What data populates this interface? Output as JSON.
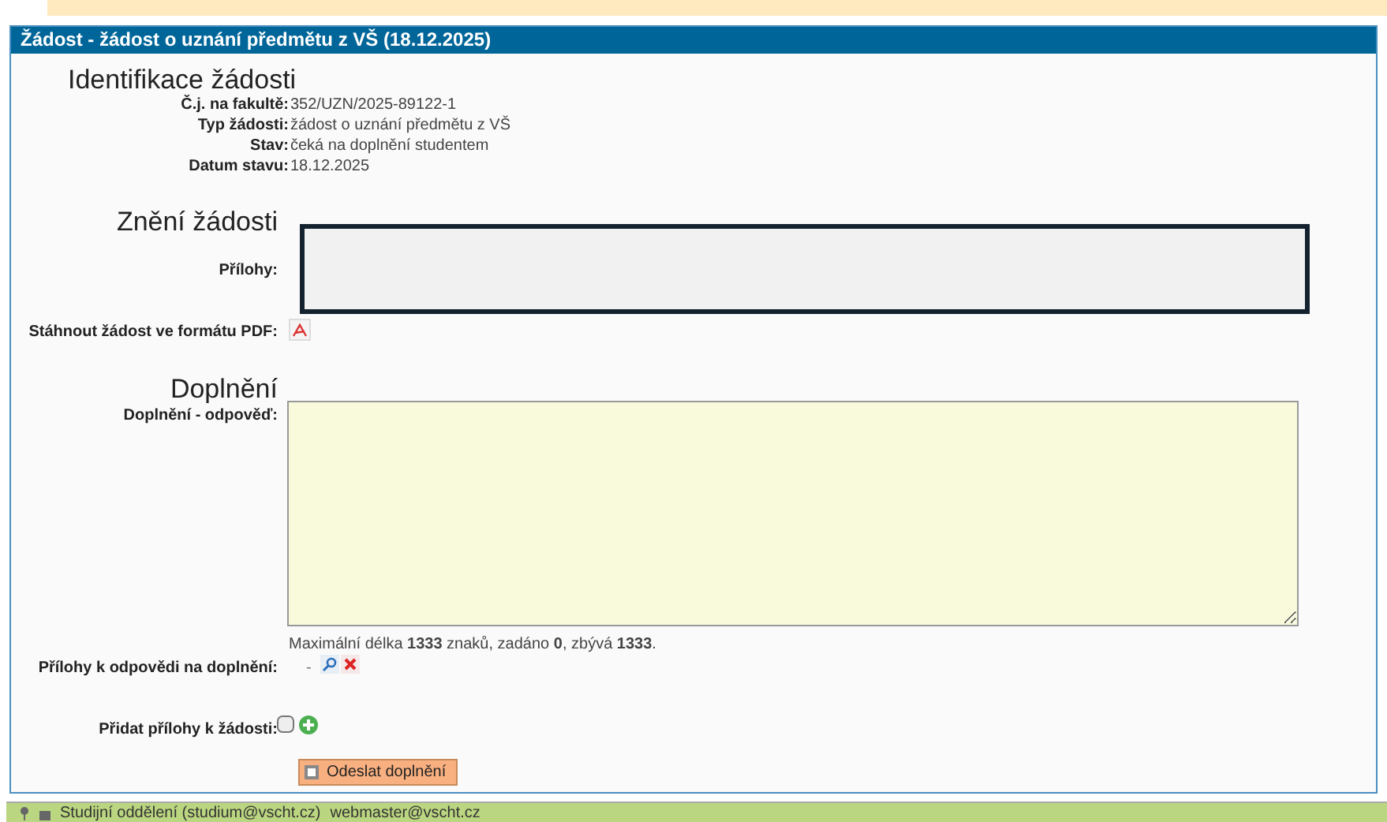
{
  "panel": {
    "title": "Žádost - žádost o uznání předmětu z VŠ (18.12.2025)"
  },
  "identification": {
    "heading": "Identifikace žádosti",
    "fields": [
      {
        "label": "Č.j. na fakultě:",
        "value": "352/UZN/2025-89122-1"
      },
      {
        "label": "Typ žádosti:",
        "value": "žádost o uznání předmětu z VŠ"
      },
      {
        "label": "Stav:",
        "value": "čeká na doplnění studentem"
      },
      {
        "label": "Datum stavu:",
        "value": "18.12.2025"
      }
    ]
  },
  "request": {
    "heading": "Znění žádosti",
    "attachments_label": "Přílohy:",
    "pdf_label": "Stáhnout žádost ve formátu PDF:"
  },
  "supplement": {
    "heading": "Doplnění",
    "answer_label": "Doplnění - odpověď:",
    "limit_note": "Maximální délka **1333** znaků, zadáno **0**, zbývá **1333**.",
    "reply_attachments_label": "Přílohy k odpovědi na doplnění:",
    "reply_attachments_value": "-",
    "add_attachments_label": "Přidat přílohy k žádosti:",
    "submit": "Odeslat doplnění"
  },
  "footer": {
    "contact": "Studijní oddělení (studium@vscht.cz)",
    "webmaster": "webmaster@vscht.cz"
  }
}
